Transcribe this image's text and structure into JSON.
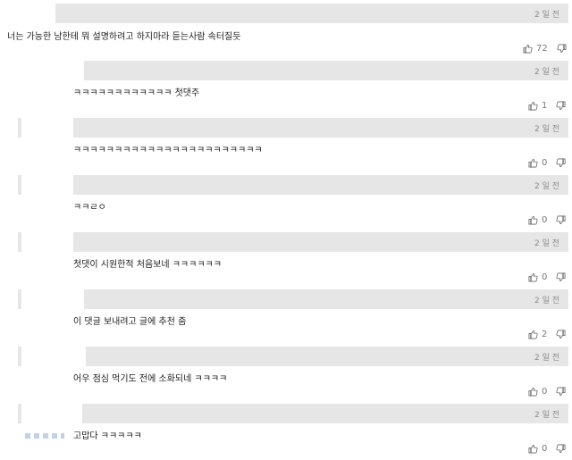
{
  "comments": [
    {
      "time": "2 일 전",
      "text": "너는 가능한 남한테 뭐 설명하려고 하지마라 듣는사람 속터질듯",
      "likes": "72"
    },
    {
      "time": "2 일 전",
      "text": "ㅋㅋㅋㅋㅋㅋㅋㅋㅋㅋㅋㅋ 첫댓주",
      "likes": "1"
    },
    {
      "time": "2 일 전",
      "text": "ㅋㅋㅋㅋㅋㅋㅋㅋㅋㅋㅋㅋㅋㅋㅋㅋㅋㅋㅋㅋㅋㅋㅋ",
      "likes": "0"
    },
    {
      "time": "2 일 전",
      "text": "ㅋㅋㄹㅇ",
      "likes": "0"
    },
    {
      "time": "2 일 전",
      "text": "첫댓이 시원한적 처음보네 ㅋㅋㅋㅋㅋㅋ",
      "likes": "0"
    },
    {
      "time": "2 일 전",
      "text": "이 댓글 보내려고 글에 추천 줌",
      "likes": "2"
    },
    {
      "time": "2 일 전",
      "text": "어우 점심 먹기도 전에 소화되네 ㅋㅋㅋㅋ",
      "likes": "0"
    },
    {
      "time": "2 일 전",
      "text": "고맙다 ㅋㅋㅋㅋㅋ",
      "likes": "0"
    }
  ],
  "icons": {
    "like": "thumbs-up-icon",
    "dislike": "thumbs-down-icon"
  },
  "colors": {
    "header_bar": "#e6e6e6",
    "time_text": "#8a8a8a"
  }
}
